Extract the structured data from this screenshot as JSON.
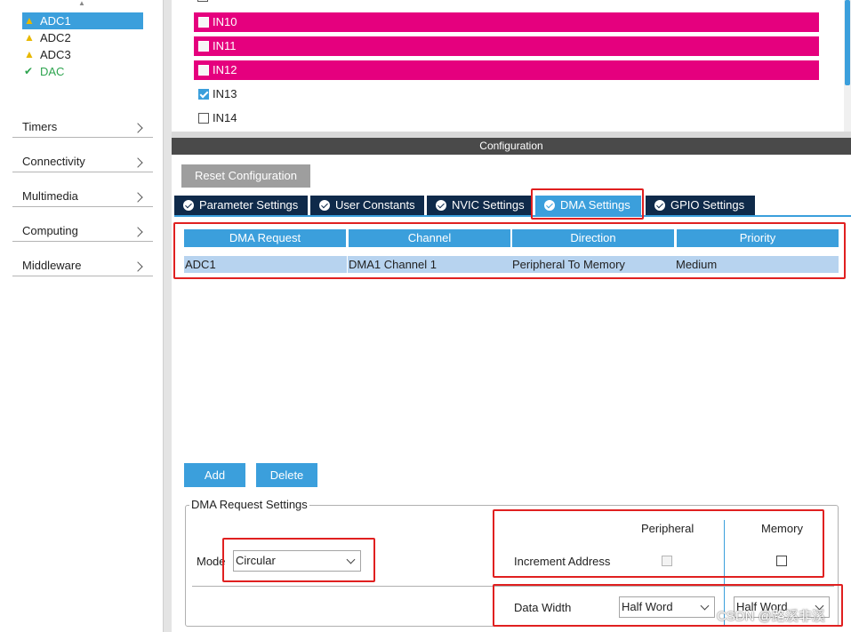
{
  "sidebar": {
    "peripherals": [
      {
        "label": "ADC1",
        "status": "warning",
        "selected": true
      },
      {
        "label": "ADC2",
        "status": "warning",
        "selected": false
      },
      {
        "label": "ADC3",
        "status": "warning",
        "selected": false
      },
      {
        "label": "DAC",
        "status": "ok",
        "selected": false
      }
    ],
    "categories": [
      "Timers",
      "Connectivity",
      "Multimedia",
      "Computing",
      "Middleware"
    ]
  },
  "channels": [
    {
      "label": "IN10",
      "highlighted": true,
      "checked": false
    },
    {
      "label": "IN11",
      "highlighted": true,
      "checked": false
    },
    {
      "label": "IN12",
      "highlighted": true,
      "checked": false
    },
    {
      "label": "IN13",
      "highlighted": false,
      "checked": true
    },
    {
      "label": "IN14",
      "highlighted": false,
      "checked": false
    }
  ],
  "config": {
    "header": "Configuration",
    "reset_label": "Reset Configuration",
    "tabs": [
      "Parameter Settings",
      "User Constants",
      "NVIC Settings",
      "DMA Settings",
      "GPIO Settings"
    ],
    "active_tab": "DMA Settings"
  },
  "dma_table": {
    "headers": [
      "DMA Request",
      "Channel",
      "Direction",
      "Priority"
    ],
    "rows": [
      [
        "ADC1",
        "DMA1 Channel 1",
        "Peripheral To Memory",
        "Medium"
      ]
    ]
  },
  "buttons": {
    "add": "Add",
    "delete": "Delete"
  },
  "request_settings": {
    "title": "DMA Request Settings",
    "mode_label": "Mode",
    "mode_value": "Circular",
    "peripheral_header": "Peripheral",
    "memory_header": "Memory",
    "increment_label": "Increment Address",
    "data_width_label": "Data Width",
    "peripheral_width": "Half Word",
    "memory_width": "Half Word"
  },
  "watermark": "CSDN @路溪非溪",
  "colors": {
    "accent": "#3b9fdc",
    "highlight": "#e5007e",
    "tab_dark": "#0f2a4a",
    "annotation": "#e02020"
  }
}
